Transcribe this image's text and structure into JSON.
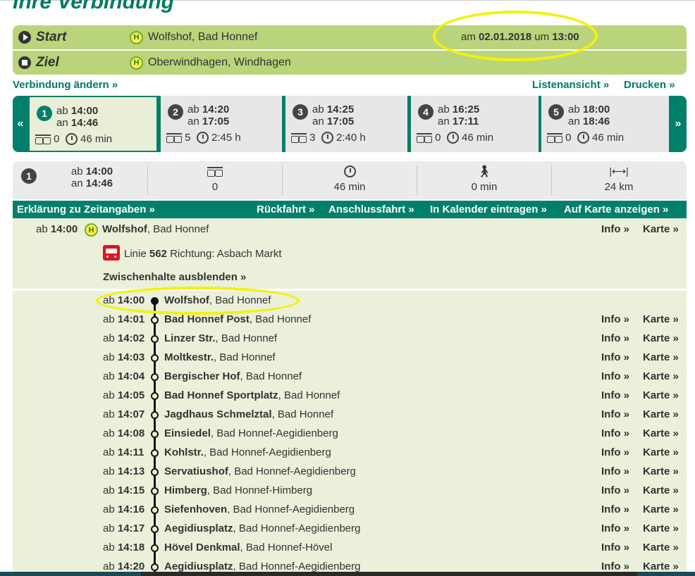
{
  "page_title": "Ihre Verbindung",
  "journey": {
    "start_label": "Start",
    "start_place": "Wolfshof, Bad Honnef",
    "date_prefix": "am",
    "date": "02.01.2018",
    "time_prefix": "um",
    "time": "13:00",
    "ziel_label": "Ziel",
    "ziel_place": "Oberwindhagen, Windhagen",
    "stop_badge": "H"
  },
  "links": {
    "change": "Verbindung ändern »",
    "list_view": "Listenansicht »",
    "print": "Drucken »"
  },
  "carousel": {
    "prev": "«",
    "next": "»",
    "options": [
      {
        "num": "1",
        "dep": "14:00",
        "arr": "14:46",
        "changes": "0",
        "duration": "46 min"
      },
      {
        "num": "2",
        "dep": "14:20",
        "arr": "17:05",
        "changes": "5",
        "duration": "2:45 h"
      },
      {
        "num": "3",
        "dep": "14:25",
        "arr": "17:05",
        "changes": "3",
        "duration": "2:40 h"
      },
      {
        "num": "4",
        "dep": "16:25",
        "arr": "17:11",
        "changes": "0",
        "duration": "46 min"
      },
      {
        "num": "5",
        "dep": "18:00",
        "arr": "18:46",
        "changes": "0",
        "duration": "46 min"
      }
    ]
  },
  "labels": {
    "ab": "ab",
    "an": "an"
  },
  "summary": {
    "num": "1",
    "dep": "14:00",
    "arr": "14:46",
    "changes": "0",
    "duration": "46 min",
    "walk": "0 min",
    "distance": "24 km"
  },
  "actions": {
    "explain": "Erklärung zu Zeitangaben »",
    "return": "Rückfahrt »",
    "connecting": "Anschlussfahrt »",
    "calendar": "In Kalender eintragen »",
    "map": "Auf Karte anzeigen »"
  },
  "leg": {
    "dep_time": "14:00",
    "stop_bold": "Wolfshof",
    "stop_rest": ", Bad Honnef",
    "line_prefix": "Linie",
    "line_number": "562",
    "direction": "Richtung: Asbach Markt",
    "toggle": "Zwischenhalte ausblenden »",
    "info": "Info »",
    "karte": "Karte »"
  },
  "stops": [
    {
      "time": "14:00",
      "name": "Wolfshof",
      "place": ", Bad Honnef"
    },
    {
      "time": "14:01",
      "name": "Bad Honnef Post",
      "place": ", Bad Honnef"
    },
    {
      "time": "14:02",
      "name": "Linzer Str.",
      "place": ", Bad Honnef"
    },
    {
      "time": "14:03",
      "name": "Moltkestr.",
      "place": ", Bad Honnef"
    },
    {
      "time": "14:04",
      "name": "Bergischer Hof",
      "place": ", Bad Honnef"
    },
    {
      "time": "14:05",
      "name": "Bad Honnef Sportplatz",
      "place": ", Bad Honnef"
    },
    {
      "time": "14:07",
      "name": "Jagdhaus Schmelztal",
      "place": ", Bad Honnef"
    },
    {
      "time": "14:08",
      "name": "Einsiedel",
      "place": ", Bad Honnef-Aegidienberg"
    },
    {
      "time": "14:11",
      "name": "Kohlstr.",
      "place": ", Bad Honnef-Aegidienberg"
    },
    {
      "time": "14:13",
      "name": "Servatiushof",
      "place": ", Bad Honnef-Aegidienberg"
    },
    {
      "time": "14:15",
      "name": "Himberg",
      "place": ", Bad Honnef-Himberg"
    },
    {
      "time": "14:16",
      "name": "Siefenhoven",
      "place": ", Bad Honnef-Aegidienberg"
    },
    {
      "time": "14:17",
      "name": "Aegidiusplatz",
      "place": ", Bad Honnef-Aegidienberg"
    },
    {
      "time": "14:18",
      "name": "Hövel Denkmal",
      "place": ", Bad Honnef-Hövel"
    },
    {
      "time": "14:20",
      "name": "Aegidiusplatz",
      "place": ", Bad Honnef-Aegidienberg"
    }
  ],
  "colors": {
    "brand_green": "#00806a",
    "light_green": "#b9d47a",
    "highlight": "#f2f20a"
  }
}
